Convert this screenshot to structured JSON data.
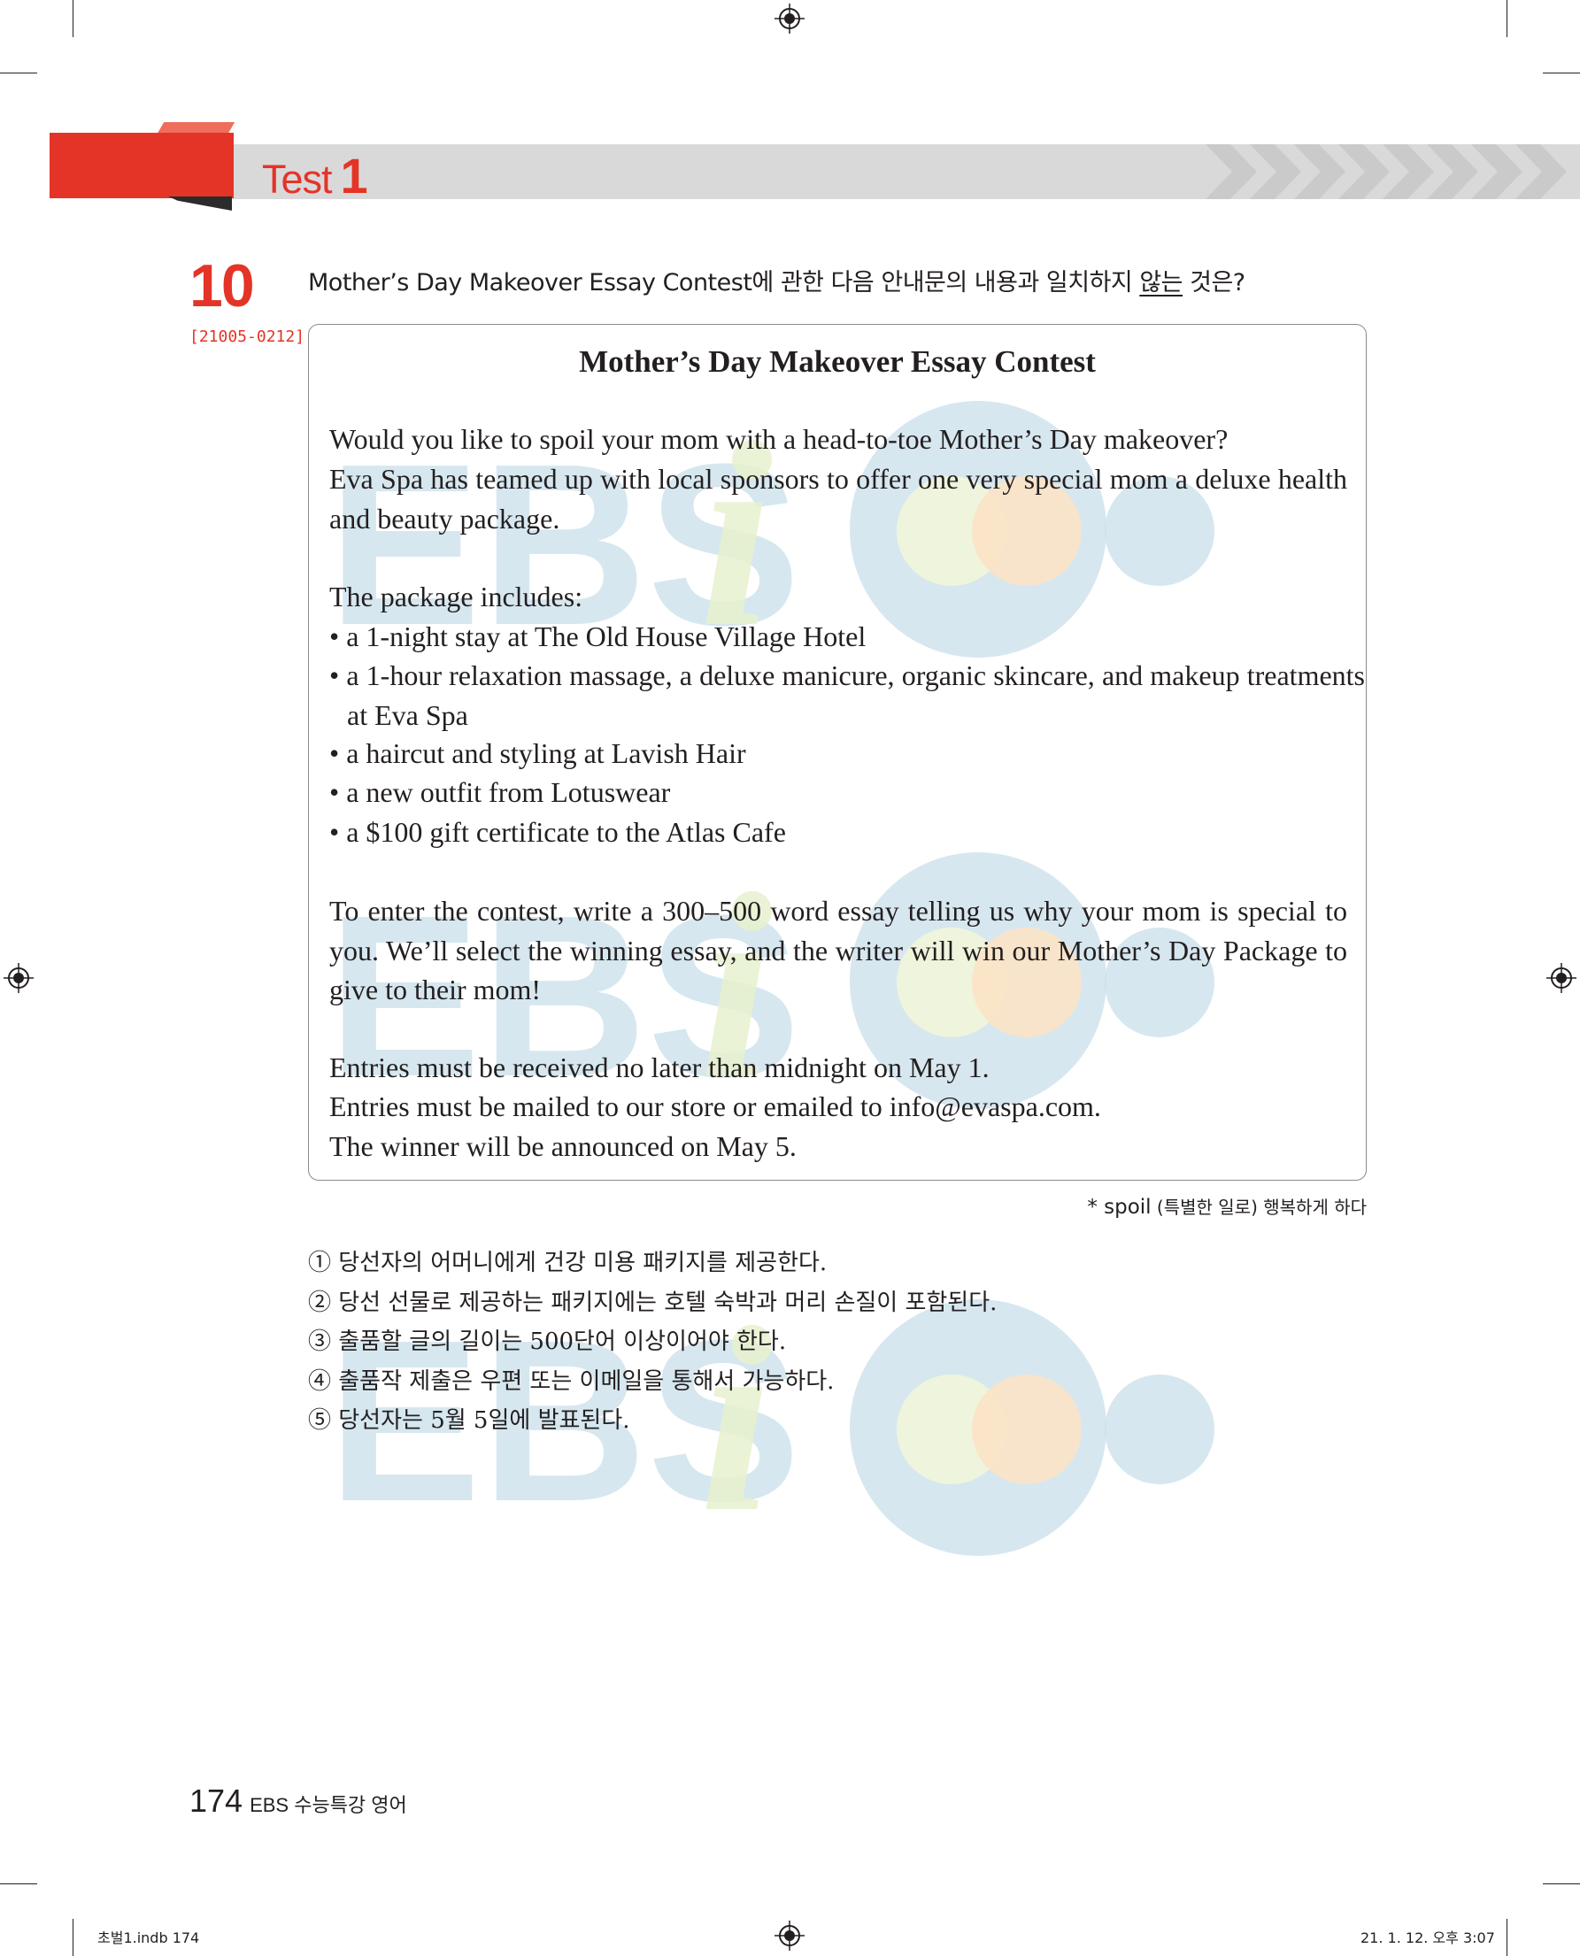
{
  "header": {
    "test_word": "Test",
    "test_number": "1"
  },
  "question": {
    "number": "10",
    "code": "[21005-0212]",
    "prompt_before": "Mother’s Day Makeover Essay Contest에 관한 다음 안내문의 내용과 일치하지 ",
    "prompt_underlined": "않는",
    "prompt_after": " 것은?"
  },
  "passage": {
    "title": "Mother’s Day Makeover Essay Contest",
    "intro_line1": "Would you like to spoil your mom with a head-to-toe Mother’s Day makeover?",
    "intro_line2": "Eva Spa has teamed up with local sponsors to offer one very special mom a deluxe health and beauty package.",
    "includes_heading": "The package includes:",
    "items": [
      "• a 1-night stay at The Old House Village Hotel",
      "• a 1-hour relaxation massage, a deluxe manicure, organic skincare, and makeup treatments at Eva Spa",
      "• a haircut and styling at Lavish Hair",
      "• a new outfit from Lotuswear",
      "• a $100 gift certificate to the Atlas Cafe"
    ],
    "entry_paragraph": "To enter the contest, write a 300–500 word essay telling us why your mom is special to you. We’ll select the winning essay, and the writer will win our Mother’s Day Package to give to their mom!",
    "rules": [
      "Entries must be received no later than midnight on May 1.",
      "Entries must be mailed to our store or emailed to info@evaspa.com.",
      "The winner will be announced on May 5."
    ]
  },
  "footnote": {
    "marker": "* spoil",
    "gloss": " (특별한 일로) 행복하게 하다"
  },
  "options": [
    "① 당선자의 어머니에게 건강 미용 패키지를 제공한다.",
    "② 당선 선물로 제공하는 패키지에는 호텔 숙박과 머리 손질이 포함된다.",
    "③ 출품할 글의 길이는 500단어 이상이어야 한다.",
    "④ 출품작 제출은 우편 또는 이메일을 통해서 가능하다.",
    "⑤ 당선자는 5월 5일에 발표된다."
  ],
  "watermark": {
    "text": "EBS",
    "letter": "i"
  },
  "footer": {
    "page_number": "174",
    "book_title": "EBS 수능특강 영어"
  },
  "slug": {
    "left": "초벌1.indb   174",
    "right": "21. 1. 12.   오후 3:07"
  },
  "colors": {
    "accent_red": "#e43427",
    "band_gray": "#d9d9da",
    "watermark_blue": "#c9dfea",
    "watermark_green": "#e8f2cf",
    "watermark_orange": "#fbe3c6"
  }
}
